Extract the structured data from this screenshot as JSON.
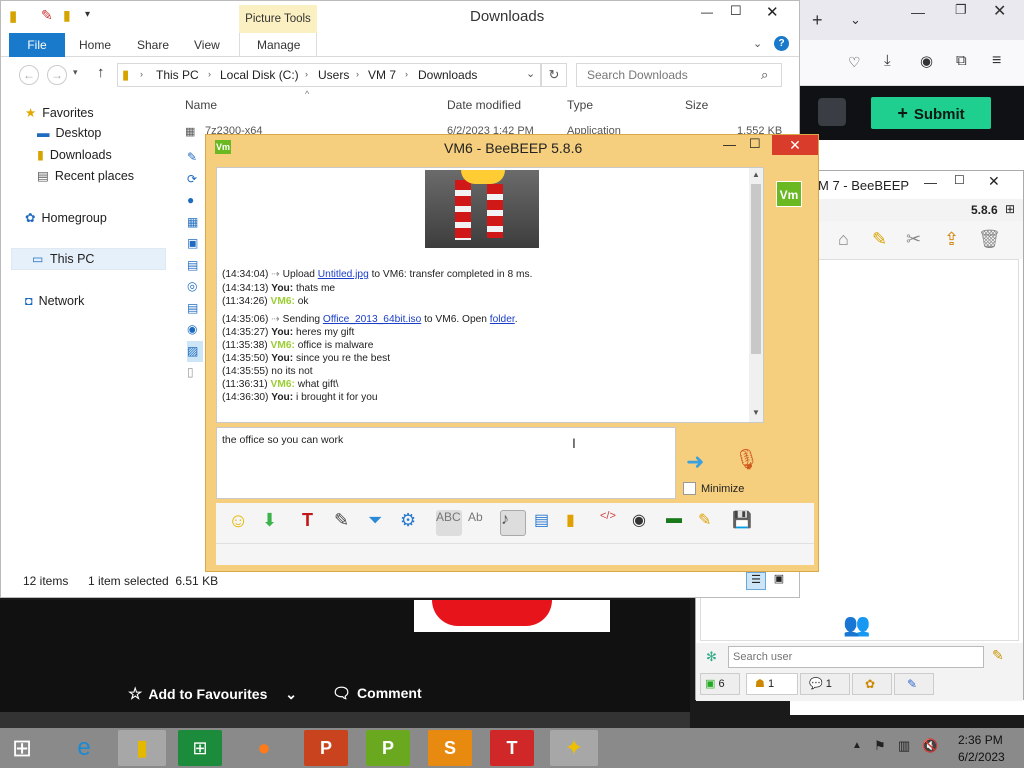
{
  "browser": {
    "submit_label": "Submit",
    "add_favourites": "Add to Favourites",
    "comment": "Comment"
  },
  "explorer": {
    "title": "Downloads",
    "picture_tools": "Picture Tools",
    "tabs": [
      "File",
      "Home",
      "Share",
      "View",
      "Manage"
    ],
    "breadcrumb": [
      "This PC",
      "Local Disk (C:)",
      "Users",
      "VM 7",
      "Downloads"
    ],
    "search_placeholder": "Search Downloads",
    "columns": {
      "name": "Name",
      "date": "Date modified",
      "type": "Type",
      "size": "Size"
    },
    "first_row": {
      "name": "7z2300-x64",
      "date": "6/2/2023 1:42 PM",
      "type": "Application",
      "size": "1,552 KB"
    },
    "nav": {
      "favorites": "Favorites",
      "desktop": "Desktop",
      "downloads": "Downloads",
      "recent": "Recent places",
      "homegroup": "Homegroup",
      "this_pc": "This PC",
      "network": "Network"
    },
    "status": {
      "items": "12 items",
      "selected": "1 item selected  6.51 KB"
    }
  },
  "beebeep": {
    "title": "VM6 - BeeBEEP 5.8.6",
    "avatar": "Vm",
    "messages": [
      {
        "time": "(14:34:04)",
        "sender": "",
        "pre": "Upload ",
        "link": "Untitled.jpg",
        "post": " to VM6: transfer completed in 8 ms."
      },
      {
        "time": "(14:34:13)",
        "sender": "You:",
        "text": "thats me"
      },
      {
        "time": "(11:34:26)",
        "sender": "VM6:",
        "text": "ok"
      },
      {
        "time": "(14:35:06)",
        "sender": "",
        "pre": "Sending ",
        "link": "Office_2013_64bit.iso",
        "post": " to VM6. Open ",
        "link2": "folder",
        "post2": "."
      },
      {
        "time": "(14:35:27)",
        "sender": "You:",
        "text": "heres my gift"
      },
      {
        "time": "(11:35:38)",
        "sender": "VM6:",
        "text": "office is malware"
      },
      {
        "time": "(14:35:50)",
        "sender": "You:",
        "text": "since you re the best"
      },
      {
        "time": "(14:35:55)",
        "sender": "",
        "text": "no its not"
      },
      {
        "time": "(11:36:31)",
        "sender": "VM6:",
        "text": "what gift\\"
      },
      {
        "time": "(14:36:30)",
        "sender": "You:",
        "text": "i brought it for you"
      }
    ],
    "input_text": "the office so you can work",
    "minimize_label": "Minimize"
  },
  "vm7": {
    "title": "M 7 - BeeBEEP",
    "version": "5.8.6",
    "search_placeholder": "Search user",
    "tabs": [
      "6",
      "1",
      "1"
    ]
  },
  "taskbar": {
    "time": "2:36 PM",
    "date": "6/2/2023"
  }
}
